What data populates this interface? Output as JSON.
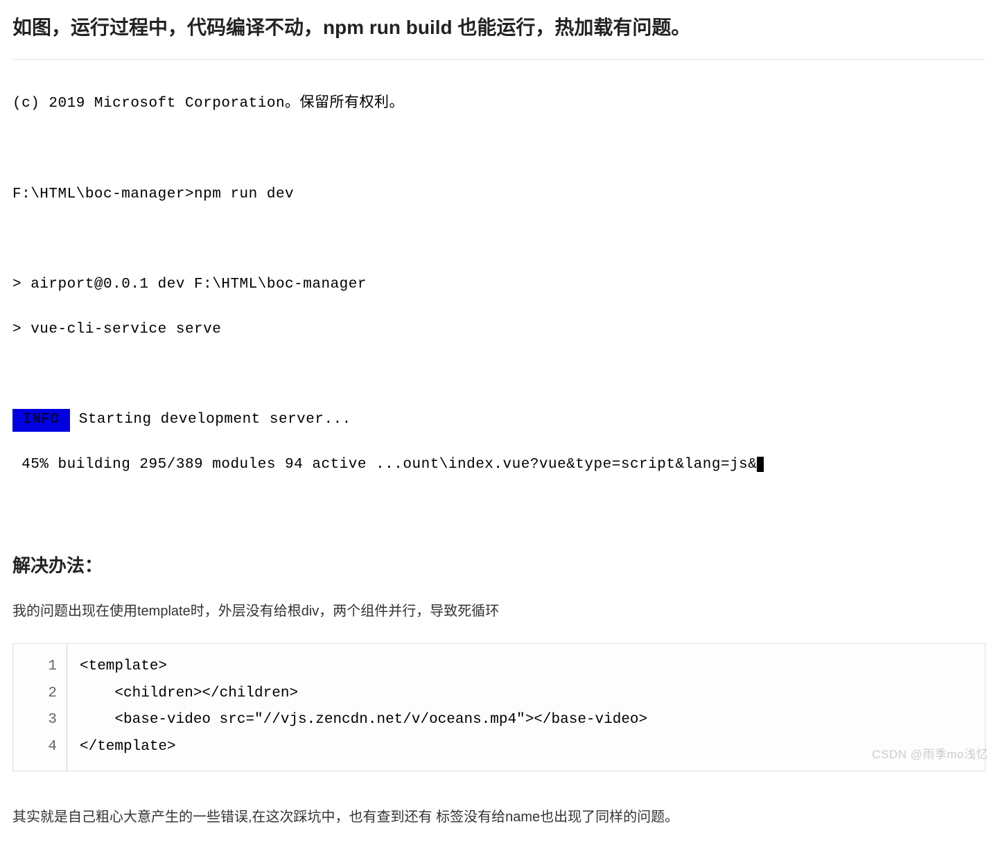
{
  "article": {
    "title": "如图，运行过程中，代码编译不动，npm run build 也能运行，热加载有问题。",
    "terminal": {
      "copyright": "(c) 2019 Microsoft Corporation。保留所有权利。",
      "prompt": "F:\\HTML\\boc-manager>npm run dev",
      "line1": "> airport@0.0.1 dev F:\\HTML\\boc-manager",
      "line2": "> vue-cli-service serve",
      "info_badge": " INFO ",
      "info_text": " Starting development server...",
      "build_text": " 45% building 295/389 modules 94 active ...ount\\index.vue?vue&type=script&lang=js&"
    },
    "solution_heading": "解决办法：",
    "solution_text": "我的问题出现在使用template时，外层没有给根div，两个组件并行，导致死循环",
    "code": {
      "lines": [
        "<template>",
        "    <children></children>",
        "    <base-video src=\"//vjs.zencdn.net/v/oceans.mp4\"></base-video>",
        "</template>"
      ]
    },
    "closing_text": "其实就是自己粗心大意产生的一些错误,在这次踩坑中，也有查到还有 标签没有给name也出现了同样的问题。"
  },
  "watermark": "CSDN @雨季mo浅忆"
}
